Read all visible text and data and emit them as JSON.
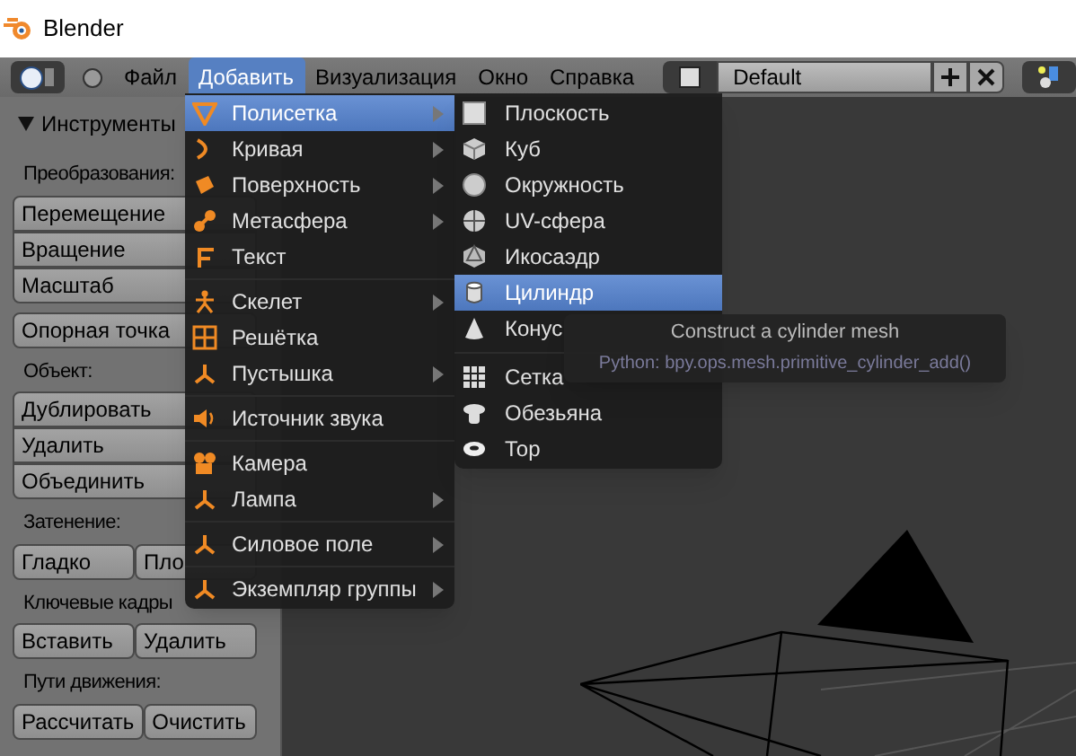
{
  "window": {
    "title": "Blender"
  },
  "menubar": {
    "items": [
      {
        "label": "Файл",
        "selected": false
      },
      {
        "label": "Добавить",
        "selected": true
      },
      {
        "label": "Визуализация",
        "selected": false
      },
      {
        "label": "Окно",
        "selected": false
      },
      {
        "label": "Справка",
        "selected": false
      }
    ],
    "layout_field": {
      "value": "Default"
    }
  },
  "tools_panel": {
    "header": "Инструменты",
    "sections": [
      {
        "label": "Преобразования:",
        "rows": [
          [
            "Перемещение"
          ],
          [
            "Вращение"
          ],
          [
            "Масштаб"
          ]
        ]
      },
      {
        "rows": [
          [
            "Опорная точка"
          ]
        ]
      },
      {
        "label": "Объект:",
        "rows": [
          [
            "Дублировать"
          ],
          [
            "Удалить"
          ],
          [
            "Объединить"
          ]
        ]
      },
      {
        "label": "Затенение:",
        "rows": [
          [
            "Гладко",
            "Пло"
          ]
        ]
      },
      {
        "label": "Ключевые кадры",
        "rows": [
          [
            "Вставить",
            "Удалить"
          ]
        ]
      },
      {
        "label": "Пути движения:",
        "rows": [
          [
            "Рассчитать",
            "Очистить"
          ]
        ]
      }
    ]
  },
  "add_menu": {
    "groups": [
      [
        {
          "label": "Полисетка",
          "submenu": true,
          "selected": true
        },
        {
          "label": "Кривая",
          "submenu": true,
          "selected": false
        },
        {
          "label": "Поверхность",
          "submenu": true,
          "selected": false
        },
        {
          "label": "Метасфера",
          "submenu": true,
          "selected": false
        },
        {
          "label": "Текст",
          "submenu": false,
          "selected": false
        }
      ],
      [
        {
          "label": "Скелет",
          "submenu": true,
          "selected": false
        },
        {
          "label": "Решётка",
          "submenu": false,
          "selected": false
        },
        {
          "label": "Пустышка",
          "submenu": true,
          "selected": false
        }
      ],
      [
        {
          "label": "Источник звука",
          "submenu": false,
          "selected": false
        }
      ],
      [
        {
          "label": "Камера",
          "submenu": false,
          "selected": false
        },
        {
          "label": "Лампа",
          "submenu": true,
          "selected": false
        }
      ],
      [
        {
          "label": "Силовое поле",
          "submenu": true,
          "selected": false
        }
      ],
      [
        {
          "label": "Экземпляр группы",
          "submenu": true,
          "selected": false
        }
      ]
    ]
  },
  "mesh_menu": {
    "groups": [
      [
        {
          "label": "Плоскость",
          "selected": false
        },
        {
          "label": "Куб",
          "selected": false
        },
        {
          "label": "Окружность",
          "selected": false
        },
        {
          "label": "UV-сфера",
          "selected": false
        },
        {
          "label": "Икосаэдр",
          "selected": false
        },
        {
          "label": "Цилиндр",
          "selected": true
        },
        {
          "label": "Конус",
          "selected": false
        }
      ],
      [
        {
          "label": "Сетка",
          "selected": false
        },
        {
          "label": "Обезьяна",
          "selected": false
        },
        {
          "label": "Тор",
          "selected": false
        }
      ]
    ]
  },
  "tooltip": {
    "title": "Construct a cylinder mesh",
    "python": "Python: bpy.ops.mesh.primitive_cylinder_add()"
  }
}
